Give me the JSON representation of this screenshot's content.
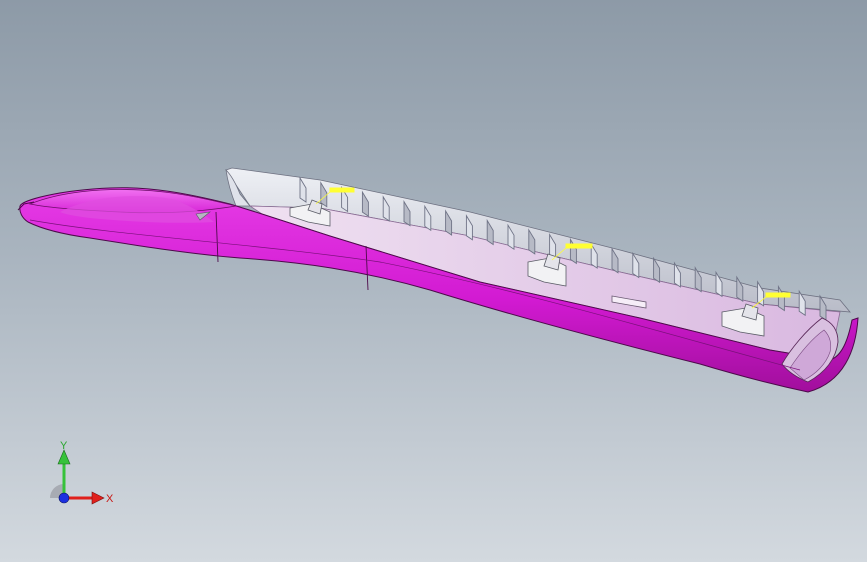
{
  "viewport": {
    "background_top": "#8d9aa7",
    "background_bottom": "#d3d9df"
  },
  "model": {
    "shell_color": "#d91ad9",
    "shell_shade": "#a5109e",
    "interior_color": "#e9d0ee",
    "rib_color": "#c9ccd6",
    "annotation_color": "#ffff33"
  },
  "triad": {
    "x_label": "X",
    "y_label": "Y",
    "x_color": "#e0201c",
    "y_color": "#36c23a",
    "z_color": "#1c2fe0"
  }
}
